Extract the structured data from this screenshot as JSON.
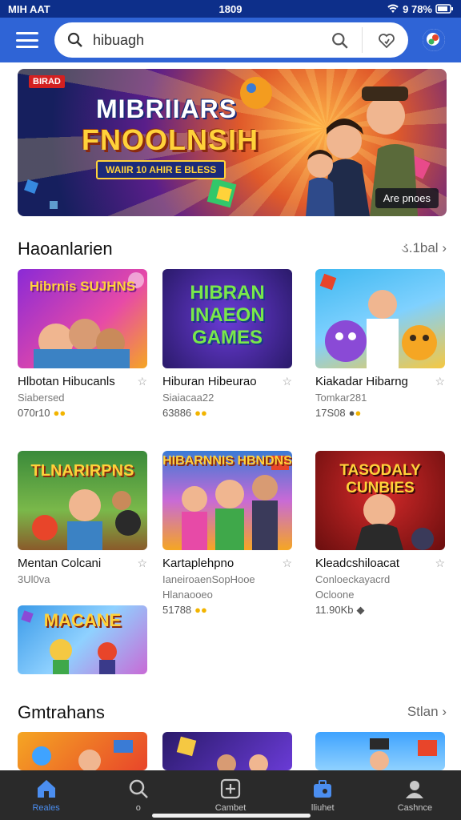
{
  "status_bar": {
    "carrier": "MIH AAT",
    "time": "1809",
    "battery": "9 78%"
  },
  "header": {
    "search_value": "hibuagh"
  },
  "banner": {
    "badge": "BIRAD",
    "title_line1": "MIBRIIARS",
    "title_line2": "FNOOLNSIH",
    "subtitle": "WAIIR 10 AHIR E BLESS",
    "chip": "Are pnoes"
  },
  "section1": {
    "title": "Haoanlarien",
    "link": "ડ.1bal",
    "cards": [
      {
        "art": "Hibrnis SUJHNS",
        "title": "Hlbotan Hibucanls",
        "sub": "Siabersed",
        "meta": "070r10"
      },
      {
        "art": "HIBRAN INAEON GAMES",
        "title": "Hiburan Hibeurao",
        "sub": "Siaiacaa22",
        "meta": "63886"
      },
      {
        "art": "",
        "title": "Kiakadar Hibarng",
        "sub": "Tomkar281",
        "meta": "17S08"
      },
      {
        "art": "TLNARIRPNS",
        "title": "Mentan Colcani",
        "sub": "3Ul0va",
        "meta": ""
      },
      {
        "art": "HIBARNNIS HBNDNS",
        "title": "Kartaplehpno",
        "sub": "IaneiroaenSopHooe",
        "sub2": "Hlanaooeo",
        "meta": "51788"
      },
      {
        "art": "TASODALY CUNBIES",
        "title": "Kleadcshiloacat",
        "sub": "Conloeckayacrd",
        "sub2": "Ocloone",
        "meta": "11.90Kb"
      },
      {
        "art": "MACANE",
        "title": "",
        "sub": "",
        "meta": ""
      }
    ]
  },
  "section2": {
    "title": "Gmtrahans",
    "link": "Stlan"
  },
  "bottom_nav": [
    {
      "label": "Reales",
      "icon": "home-icon"
    },
    {
      "label": "o",
      "icon": "search-icon"
    },
    {
      "label": "Cambet",
      "icon": "plus-box-icon"
    },
    {
      "label": "lliuhet",
      "icon": "briefcase-icon"
    },
    {
      "label": "Cashnce",
      "icon": "user-icon"
    }
  ],
  "colors": {
    "header": "#2f64d6",
    "status": "#0d2f8a",
    "accent": "#4b8ef0",
    "nav_bg": "#2a2a2a"
  }
}
